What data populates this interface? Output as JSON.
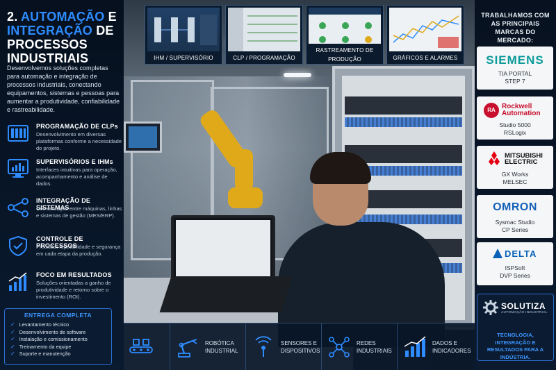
{
  "title": {
    "number": "2.",
    "word1": "AUTOMAÇÃO",
    "word2": "E",
    "word3": "INTEGRAÇÃO",
    "word4": "DE",
    "line3": "PROCESSOS INDUSTRIAIS"
  },
  "intro": "Desenvolvemos soluções completas para automação e integração de processos industriais, conectando equipamentos, sistemas e pessoas para aumentar a produtividade, confiabilidade e rastreabilidade.",
  "features": [
    {
      "icon": "plc-icon",
      "title": "PROGRAMAÇÃO DE CLPs",
      "desc": "Desenvolvimento em diversas plataformas conforme a necessidade do projeto."
    },
    {
      "icon": "monitor-chart-icon",
      "title": "SUPERVISÓRIOS E IHMs",
      "desc": "Interfaces intuitivas para operação, acompanhamento e análise de dados."
    },
    {
      "icon": "network-nodes-icon",
      "title": "INTEGRAÇÃO DE SISTEMAS",
      "desc": "Comunicação entre máquinas, linhas e sistemas de gestão (MES/ERP)."
    },
    {
      "icon": "shield-check-icon",
      "title": "CONTROLE DE PROCESSOS",
      "desc": "Precisão, repetibilidade e segurança em cada etapa da produção."
    },
    {
      "icon": "growth-chart-icon",
      "title": "FOCO EM RESULTADOS",
      "desc": "Soluções orientadas a ganho de produtividade e retorno sobre o investimento (ROI)."
    }
  ],
  "delivery": {
    "title": "ENTREGA COMPLETA",
    "items": [
      "Levantamento técnico",
      "Desenvolvimento de software",
      "Instalação e comissionamento",
      "Treinamento da equipe",
      "Suporte e manutenção"
    ]
  },
  "thumbnails": [
    {
      "label": "IHM / SUPERVISÓRIO"
    },
    {
      "label": "CLP / PROGRAMAÇÃO"
    },
    {
      "label": "RASTREAMENTO DE PRODUÇÃO"
    },
    {
      "label": "GRÁFICOS E ALARMES"
    }
  ],
  "strip": [
    {
      "icon": "conveyor-icon",
      "label": ""
    },
    {
      "icon": "robot-arm-icon",
      "label": "ROBÓTICA INDUSTRIAL"
    },
    {
      "icon": "sensor-icon",
      "label": "SENSORES E DISPOSITIVOS"
    },
    {
      "icon": "network-icon",
      "label": "REDES INDUSTRIAIS"
    },
    {
      "icon": "bar-chart-icon",
      "label": "DADOS E INDICADORES"
    }
  ],
  "brands": {
    "heading": "TRABALHAMOS COM AS PRINCIPAIS MARCAS DO MERCADO:",
    "items": [
      {
        "logo": "SIEMENS",
        "line1": "TIA PORTAL",
        "line2": "STEP 7"
      },
      {
        "logo": "Rockwell Automation",
        "logo_a": "Rockwell",
        "logo_b": "Automation",
        "badge": "RA",
        "line1": "Studio 5000",
        "line2": "RSLogix"
      },
      {
        "logo": "MITSUBISHI ELECTRIC",
        "logo_a": "MITSUBISHI",
        "logo_b": "ELECTRIC",
        "line1": "GX Works",
        "line2": "MELSEC"
      },
      {
        "logo": "OMRON",
        "line1": "Sysmac Studio",
        "line2": "CP Series"
      },
      {
        "logo": "DELTA",
        "line1": "ISPSoft",
        "line2": "DVP Series"
      }
    ]
  },
  "company": {
    "name": "SOLUTIZA",
    "subtitle": "AUTOMAÇÃO INDUSTRIAL",
    "tagline": "TECNOLOGIA, INTEGRAÇÃO E RESULTADOS PARA A INDÚSTRIA."
  },
  "colors": {
    "accent": "#2e8cff",
    "background": "#07111f",
    "siemens": "#0a9a9a",
    "rockwell": "#c8102e",
    "omron": "#1460b8",
    "delta": "#0a62b8"
  }
}
